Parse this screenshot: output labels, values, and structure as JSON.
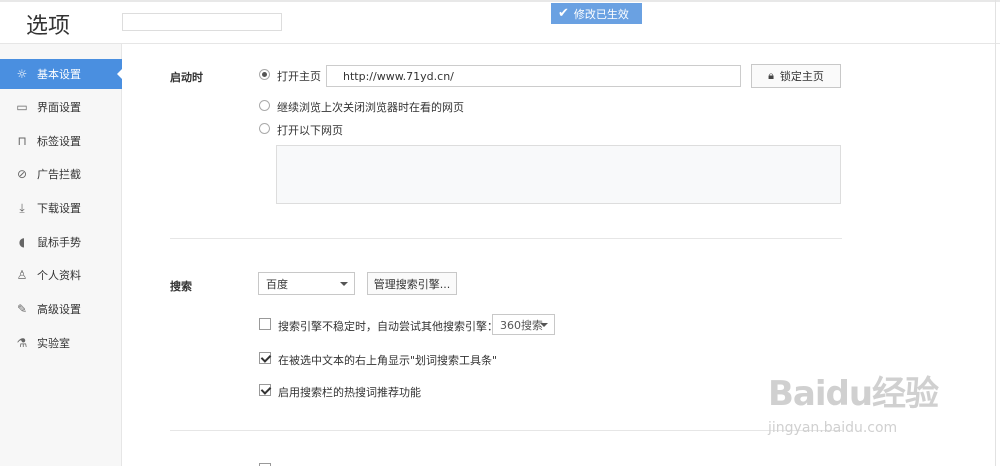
{
  "header": {
    "title": "选项",
    "search_placeholder": "",
    "toast": "修改已生效"
  },
  "sidebar": {
    "items": [
      {
        "label": "基本设置",
        "icon": "gear-icon"
      },
      {
        "label": "界面设置",
        "icon": "window-icon"
      },
      {
        "label": "标签设置",
        "icon": "tab-icon"
      },
      {
        "label": "广告拦截",
        "icon": "block-icon"
      },
      {
        "label": "下载设置",
        "icon": "download-icon"
      },
      {
        "label": "鼠标手势",
        "icon": "mouse-icon"
      },
      {
        "label": "个人资料",
        "icon": "user-icon"
      },
      {
        "label": "高级设置",
        "icon": "wrench-icon"
      },
      {
        "label": "实验室",
        "icon": "flask-icon"
      }
    ]
  },
  "startup": {
    "section_label": "启动时",
    "opt_home": "打开主页",
    "home_url": "http://www.71yd.cn/",
    "lock_label": "锁定主页",
    "opt_continue": "继续浏览上次关闭浏览器时在看的网页",
    "opt_pages": "打开以下网页"
  },
  "search": {
    "section_label": "搜索",
    "engine_value": "百度",
    "manage_label": "管理搜索引擎...",
    "fallback_text": "搜索引擎不稳定时，自动尝试其他搜索引擎：",
    "fallback_engine": "360搜索",
    "toolbar_text": "在被选中文本的右上角显示\"划词搜索工具条\"",
    "hot_text": "启用搜索栏的热搜词推荐功能"
  },
  "watermark": {
    "brand": "Baidu经验",
    "url": "jingyan.baidu.com"
  }
}
